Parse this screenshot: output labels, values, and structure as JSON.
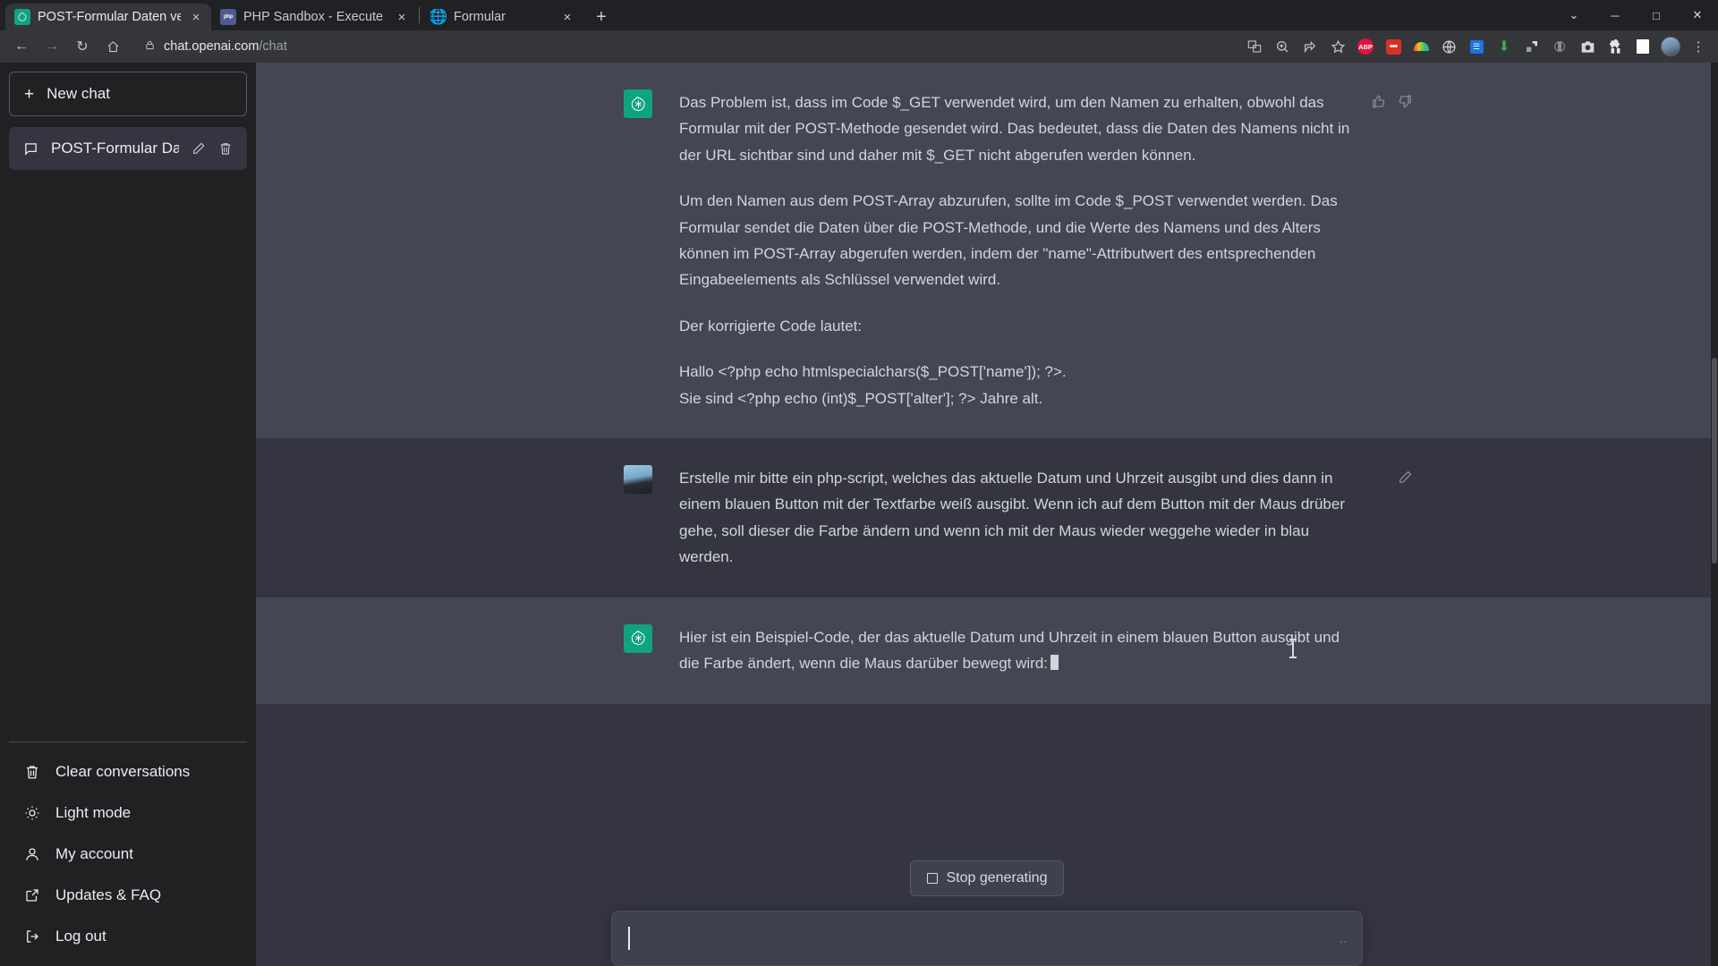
{
  "browser": {
    "tabs": [
      {
        "title": "POST-Formular Daten verarbeiten",
        "favicon": "chatgpt-icon",
        "active": true,
        "close_label": "×"
      },
      {
        "title": "PHP Sandbox - Execute PHP code",
        "favicon": "php-icon",
        "active": false,
        "close_label": "×"
      },
      {
        "title": "Formular",
        "favicon": "globe-icon",
        "active": false,
        "close_label": "×"
      }
    ],
    "new_tab_label": "+",
    "window_controls": {
      "minimize": "─",
      "maximize": "□",
      "close": "✕",
      "chevron": "⌄"
    },
    "nav": {
      "back": "←",
      "forward": "→",
      "reload": "↻",
      "home": "⌂"
    },
    "address": {
      "lock_icon": "lock-icon",
      "host": "chat.openai.com",
      "path": "/chat"
    },
    "extensions": [
      {
        "name": "translate-icon",
        "glyph": "⧉"
      },
      {
        "name": "zoom-search-icon",
        "glyph": "⌕"
      },
      {
        "name": "share-icon",
        "glyph": "↱"
      },
      {
        "name": "bookmark-star-icon",
        "glyph": "☆"
      },
      {
        "name": "adblock-plus-icon",
        "glyph": "ABP"
      },
      {
        "name": "red-dots-extension-icon",
        "glyph": "•••"
      },
      {
        "name": "rainbow-extension-icon",
        "glyph": ""
      },
      {
        "name": "globe-extension-icon",
        "glyph": "⊕"
      },
      {
        "name": "blue-badge-extension-icon",
        "glyph": "☰"
      },
      {
        "name": "download-arrow-icon",
        "glyph": "⬇"
      },
      {
        "name": "pocket-extension-icon",
        "glyph": "⬛"
      },
      {
        "name": "eye-extension-icon",
        "glyph": "◐"
      },
      {
        "name": "screenshot-camera-icon",
        "glyph": "📷"
      },
      {
        "name": "puzzle-extensions-icon",
        "glyph": "❖"
      },
      {
        "name": "sidepanel-icon",
        "glyph": "◻"
      },
      {
        "name": "profile-avatar-icon",
        "glyph": ""
      },
      {
        "name": "chrome-menu-icon",
        "glyph": "⋮"
      }
    ]
  },
  "sidebar": {
    "new_chat": {
      "label": "New chat",
      "plus": "+"
    },
    "conversations": [
      {
        "label": "POST-Formular Daten v",
        "chat_icon": "chat-bubble-icon",
        "edit_icon": "pencil-icon",
        "delete_icon": "trash-icon",
        "active": true
      }
    ],
    "menu": [
      {
        "label": "Clear conversations",
        "icon": "trash-icon"
      },
      {
        "label": "Light mode",
        "icon": "sun-icon"
      },
      {
        "label": "My account",
        "icon": "user-icon"
      },
      {
        "label": "Updates & FAQ",
        "icon": "external-link-icon"
      },
      {
        "label": "Log out",
        "icon": "logout-icon"
      }
    ]
  },
  "conversation": {
    "messages": [
      {
        "role": "assistant",
        "avatar": "chatgpt-logo-icon",
        "paragraphs": [
          "Das Problem ist, dass im Code $_GET verwendet wird, um den Namen zu erhalten, obwohl das Formular mit der POST-Methode gesendet wird. Das bedeutet, dass die Daten des Namens nicht in der URL sichtbar sind und daher mit $_GET nicht abgerufen werden können.",
          "Um den Namen aus dem POST-Array abzurufen, sollte im Code $_POST verwendet werden. Das Formular sendet die Daten über die POST-Methode, und die Werte des Namens und des Alters können im POST-Array abgerufen werden, indem der \"name\"-Attributwert des entsprechenden Eingabeelements als Schlüssel verwendet wird.",
          "Der korrigierte Code lautet:"
        ],
        "code_lines": [
          "Hallo <?php echo htmlspecialchars($_POST['name']); ?>.",
          "Sie sind <?php echo (int)$_POST['alter']; ?> Jahre alt."
        ],
        "actions": {
          "thumbs_up": "👍",
          "thumbs_down": "👎"
        }
      },
      {
        "role": "user",
        "avatar": "user-photo-avatar",
        "paragraphs": [
          "Erstelle mir bitte ein php-script, welches das aktuelle Datum und Uhrzeit ausgibt und dies dann in einem blauen Button mit der Textfarbe weiß ausgibt. Wenn ich auf dem Button mit der Maus drüber gehe, soll dieser die Farbe ändern und wenn ich mit der Maus wieder weggehe wieder in blau werden."
        ],
        "code_lines": [],
        "actions": {
          "edit": "✎"
        }
      },
      {
        "role": "assistant",
        "avatar": "chatgpt-logo-icon",
        "paragraphs": [
          "Hier ist ein Beispiel-Code, der das aktuelle Datum und Uhrzeit in einem blauen Button ausgibt und die Farbe ändert, wenn die Maus darüber bewegt wird:"
        ],
        "code_lines": [],
        "streaming": true,
        "actions": {}
      }
    ]
  },
  "composer": {
    "stop_button_label": "Stop generating",
    "input_value": "",
    "input_placeholder": "",
    "resize_handle": ".."
  },
  "colors": {
    "accent_green": "#10a37f",
    "sidebar_bg": "#202123",
    "chat_bg": "#343541",
    "assistant_bg": "#444654",
    "composer_bg": "#40414f",
    "text_primary": "#d1d5db"
  }
}
